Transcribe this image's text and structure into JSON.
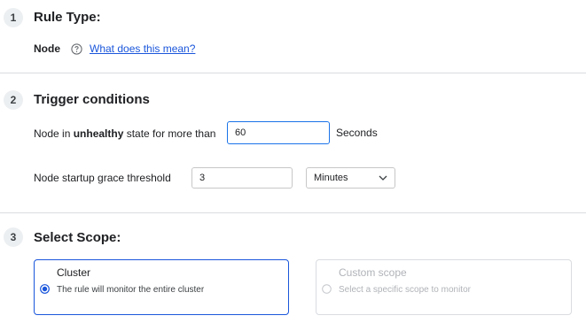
{
  "sections": [
    {
      "number": "1",
      "title": "Rule Type:"
    },
    {
      "number": "2",
      "title": "Trigger conditions"
    },
    {
      "number": "3",
      "title": "Select Scope:"
    }
  ],
  "rule_type": {
    "value": "Node",
    "help_link": "What does this mean?",
    "help_icon": "question-circle-icon"
  },
  "trigger": {
    "prefix": "Node in ",
    "emphasis": "unhealthy",
    "suffix": " state for more than",
    "value": "60",
    "unit": "Seconds",
    "grace_label": "Node startup grace threshold",
    "grace_value": "3",
    "grace_unit": "Minutes",
    "grace_unit_icon": "chevron-down-icon"
  },
  "scope": {
    "options": [
      {
        "title": "Cluster",
        "description": "The rule will monitor the entire cluster",
        "selected": true,
        "disabled": false
      },
      {
        "title": "Custom scope",
        "description": "Select a specific scope to monitor",
        "selected": false,
        "disabled": true
      }
    ]
  },
  "colors": {
    "accent": "#1a56db",
    "focus": "#1a73e8",
    "divider": "#dadce0",
    "disabled_text": "#b0b3b8"
  }
}
